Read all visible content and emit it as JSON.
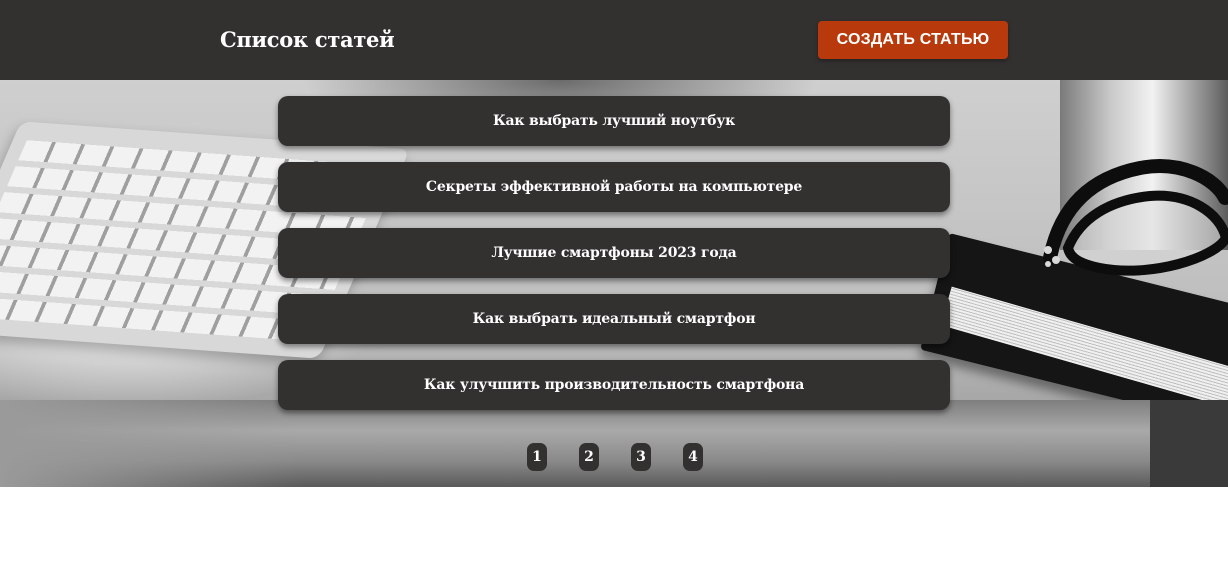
{
  "header": {
    "title": "Список статей",
    "create_button_label": "СОЗДАТЬ СТАТЬЮ"
  },
  "articles": [
    {
      "title": "Как выбрать лучший ноутбук"
    },
    {
      "title": "Секреты эффективной работы на компьютере"
    },
    {
      "title": "Лучшие смартфоны 2023 года"
    },
    {
      "title": "Как выбрать идеальный смартфон"
    },
    {
      "title": "Как улучшить производительность смартфона"
    }
  ],
  "pagination": {
    "pages": [
      "1",
      "2",
      "3",
      "4"
    ]
  },
  "colors": {
    "header_bg": "#333030",
    "accent_button": "#b83a0c",
    "item_bg": "#333030",
    "text": "#ffffff"
  },
  "background": {
    "icon": "desk-photo-keyboard-glasses-notebook"
  }
}
